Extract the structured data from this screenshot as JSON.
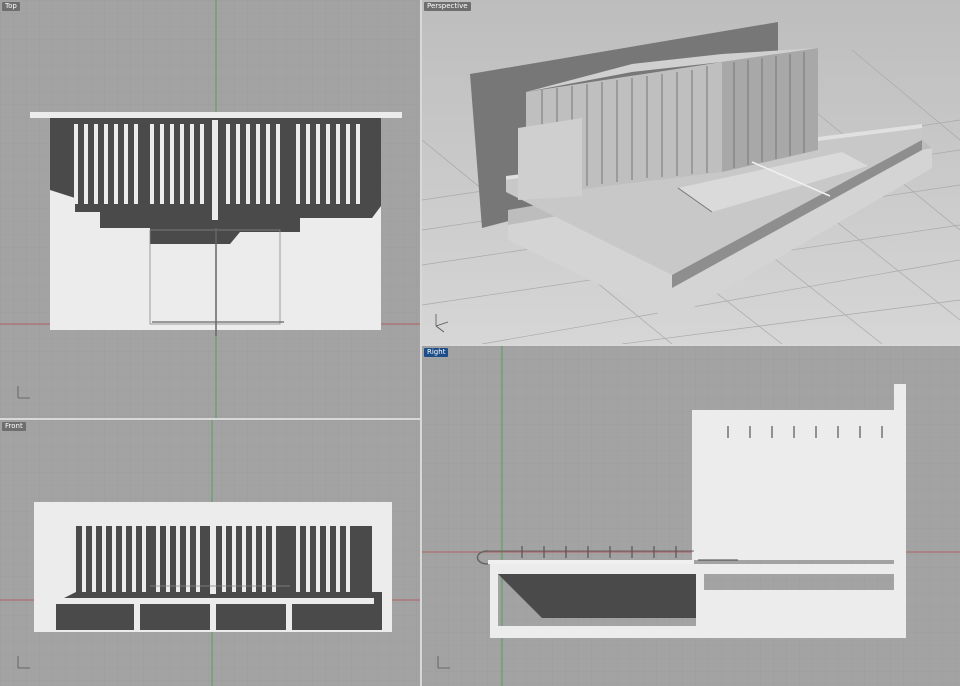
{
  "viewports": {
    "top": {
      "label": "Top",
      "active": false
    },
    "perspective": {
      "label": "Perspective",
      "active": false
    },
    "front": {
      "label": "Front",
      "active": false
    },
    "right": {
      "label": "Right",
      "active": true
    }
  },
  "colors": {
    "grid_background": "#a3a3a3",
    "grid_line": "#9a9a9a",
    "grid_major": "#8c8c8c",
    "x_axis": "#b54a4a",
    "y_axis": "#3ca04a",
    "model_light": "#ececec",
    "model_shadow": "#4a4a4a",
    "active_label": "#1d4d89",
    "inactive_label": "#6e6e6e"
  },
  "icons": [
    "axis-gizmo-icon"
  ]
}
